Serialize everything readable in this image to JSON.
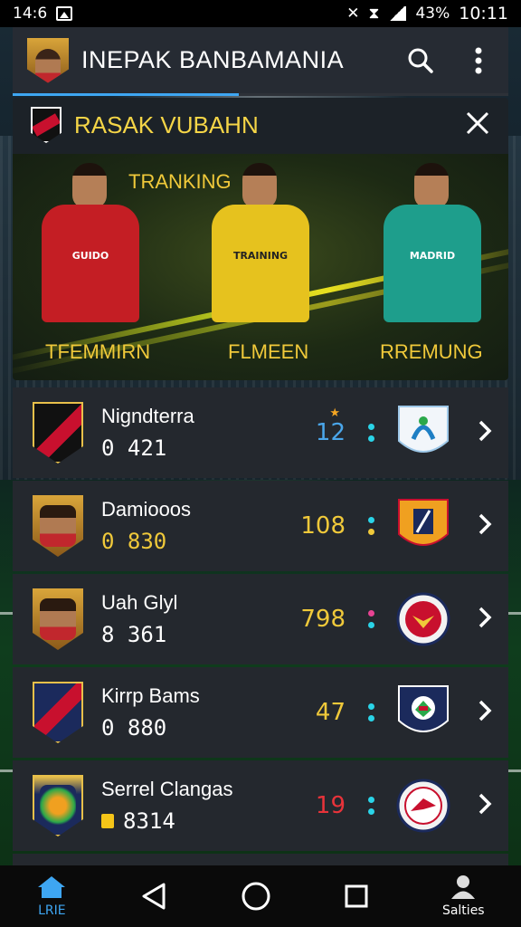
{
  "status_bar": {
    "time_left": "14:6",
    "battery": "43%",
    "time_right": "10:11"
  },
  "app_bar": {
    "title": "INEPAK BANBAMANIA"
  },
  "card": {
    "title": "RASAK VUBAHN",
    "hero_label": "TRANKING",
    "players": [
      {
        "label": "TFEMMIRN",
        "jersey": "GUIDO",
        "color": "#c41e24"
      },
      {
        "label": "FLMEEN",
        "jersey": "TRAINING",
        "color": "#e6c21e"
      },
      {
        "label": "RREMUNG",
        "jersey": "MADRID",
        "color": "#1e9e8c"
      }
    ]
  },
  "list": [
    {
      "name": "Nigndterra",
      "sub": "0 421",
      "score": "12",
      "score_color": "#4aa6ea",
      "star": "★",
      "dot_colors": [
        "#2ad4e8",
        "#2ad4e8"
      ],
      "crest": "red-black-shield",
      "badge": "blue-white-shield"
    },
    {
      "name": "Damiooos",
      "sub": "0 830",
      "score": "108",
      "score_color": "#f0c93a",
      "star": "",
      "dot_colors": [
        "#2ad4e8",
        "#f0c93a"
      ],
      "crest": "player-portrait",
      "badge": "orange-shield"
    },
    {
      "name": "Uah Glyl",
      "sub": "8 361",
      "score": "798",
      "score_color": "#f0c93a",
      "star": "",
      "dot_colors": [
        "#e84393",
        "#2ad4e8"
      ],
      "crest": "player-portrait",
      "badge": "red-round-crest"
    },
    {
      "name": "Kirrp Bams",
      "sub": "0 880",
      "score": "47",
      "score_color": "#f0c93a",
      "star": "",
      "dot_colors": [
        "#2ad4e8",
        "#2ad4e8"
      ],
      "crest": "red-navy-crest",
      "badge": "navy-shield"
    },
    {
      "name": "Serrel Clangas",
      "sub": "8314",
      "score": "19",
      "score_color": "#e8333a",
      "star": "",
      "dot_colors": [
        "#2ad4e8",
        "#2ad4e8"
      ],
      "crest": "navy-gold-crest",
      "badge": "red-round-crest"
    }
  ],
  "nav": {
    "home_label": "LRIE",
    "profile_label": "Salties"
  },
  "colors": {
    "accent": "#3ea6f2",
    "gold": "#f0c93a",
    "row_bg": "#24282e"
  }
}
